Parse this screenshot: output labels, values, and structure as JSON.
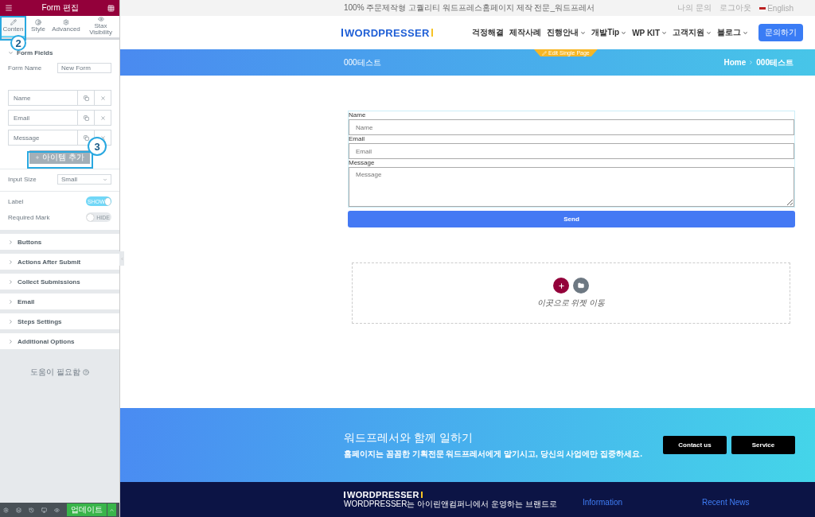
{
  "editor_panel": {
    "title": "Form 편집",
    "tabs": [
      {
        "label": "Conten",
        "kind": "content",
        "selected": true
      },
      {
        "label": "Style",
        "kind": "style",
        "selected": false
      },
      {
        "label": "Advanced",
        "kind": "advanced",
        "selected": false
      },
      {
        "label": "Stax Visibility",
        "kind": "visibility",
        "selected": false
      }
    ],
    "section_title": "Form Fields",
    "form_name": {
      "label": "Form Name",
      "value": "New Form"
    },
    "fields": [
      "Name",
      "Email",
      "Message"
    ],
    "add_item": "아이템 추가",
    "input_size": {
      "label": "Input Size",
      "value": "Small"
    },
    "toggles": [
      {
        "label": "Label",
        "on": true,
        "text": "SHOW"
      },
      {
        "label": "Required Mark",
        "on": false,
        "text": "HIDE"
      }
    ],
    "sections": [
      "Buttons",
      "Actions After Submit",
      "Collect Submissions",
      "Email",
      "Steps Settings",
      "Additional Options"
    ],
    "help": "도움이 필요함",
    "update_button": "업데이트"
  },
  "annotations": [
    {
      "text": "2"
    },
    {
      "text": "3"
    }
  ],
  "site": {
    "topbar": {
      "tagline": "100% 주문제작형 고퀄리티 워드프레스홈페이지 제작 전문_워드프레서",
      "links": [
        "나의 문의",
        "로그아웃"
      ],
      "language": "English"
    },
    "logo": "WORDPRESSER",
    "nav": [
      {
        "label": "걱정해결",
        "dropdown": false
      },
      {
        "label": "제작사례",
        "dropdown": false
      },
      {
        "label": "진행안내",
        "dropdown": true
      },
      {
        "label": "개발Tip",
        "dropdown": true
      },
      {
        "label": "WP KIT",
        "dropdown": true
      },
      {
        "label": "고객지원",
        "dropdown": true
      },
      {
        "label": "블로그",
        "dropdown": true
      }
    ],
    "cta": "문의하기",
    "edit_badge": "Edit Single Page",
    "page_title": "000테스트",
    "breadcrumb": [
      "Home",
      "000테스트"
    ],
    "form": {
      "fields": [
        {
          "label": "Name",
          "placeholder": "Name",
          "kind": "input"
        },
        {
          "label": "Email",
          "placeholder": "Email",
          "kind": "input"
        },
        {
          "label": "Message",
          "placeholder": "Message",
          "kind": "textarea"
        }
      ],
      "submit": "Send"
    },
    "dropzone": {
      "hint": "이곳으로 위젯 이동"
    },
    "cta_banner": {
      "title": "워드프레서와 함께 일하기",
      "subtitle": "홈페이지는 꼼꼼한 기획전문 워드프레서에게 맡기시고, 당신의 사업에만 집중하세요.",
      "buttons": [
        "Contact us",
        "Service"
      ]
    },
    "footer": {
      "logo": "WORDPRESSER",
      "text": "WORDPRESSER는 아이린앤컴퍼니에서 운영하는 브랜드로",
      "columns": [
        "Information",
        "Recent News"
      ]
    }
  }
}
